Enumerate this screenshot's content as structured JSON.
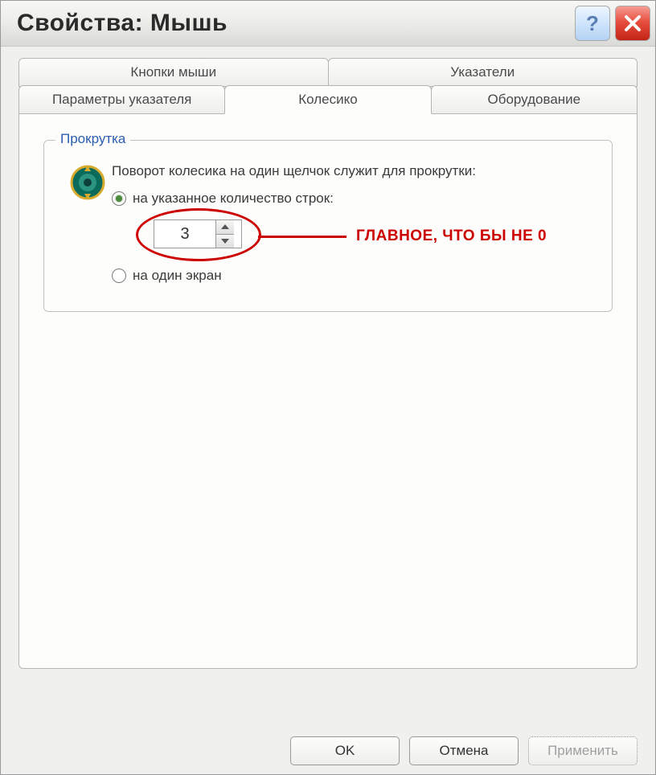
{
  "window": {
    "title": "Свойства: Мышь"
  },
  "tabs": {
    "row1": [
      "Кнопки мыши",
      "Указатели"
    ],
    "row2": [
      "Параметры указателя",
      "Колесико",
      "Оборудование"
    ]
  },
  "group": {
    "legend": "Прокрутка",
    "heading": "Поворот колесика на один щелчок служит для прокрутки:",
    "radio_lines": "на указанное количество строк:",
    "radio_screen": "на один экран",
    "spinner_value": "3"
  },
  "annotation": {
    "text": "ГЛАВНОЕ, ЧТО БЫ НЕ 0"
  },
  "buttons": {
    "ok": "OK",
    "cancel": "Отмена",
    "apply": "Применить"
  }
}
